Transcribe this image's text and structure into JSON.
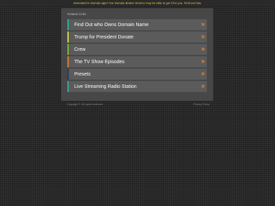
{
  "banner": {
    "text": "Interested in Domain.app? Our Domain Broker Service may be able to get it for you. Find out how."
  },
  "panel": {
    "heading": "Related Links",
    "links": [
      {
        "label": "Find Out who Owns Domain Name",
        "accent": "#2bb0a0",
        "icon": "double-chevron-right-icon"
      },
      {
        "label": "Trump for President Donate",
        "accent": "#d8d24a",
        "icon": "double-chevron-right-icon"
      },
      {
        "label": "Crew",
        "accent": "#7ab840",
        "icon": "double-chevron-right-icon"
      },
      {
        "label": "The TV Show Episodes",
        "accent": "#e07a2e",
        "icon": "double-chevron-right-icon"
      },
      {
        "label": "Presets",
        "accent": "#2a3a5a",
        "icon": "double-chevron-right-icon"
      },
      {
        "label": "Live Streaming Radio Station",
        "accent": "#3aa8a0",
        "icon": "double-chevron-right-icon"
      }
    ],
    "chevron_glyph": "»"
  },
  "footer": {
    "copyright": "Copyright ©. All rights reserved.",
    "privacy": "Privacy Policy"
  },
  "colors": {
    "background": "#2e2e2e",
    "panel": "#474747",
    "link_background": "#5b5b5b",
    "banner_text": "#e6c34a",
    "chevron": "#e8872a"
  }
}
